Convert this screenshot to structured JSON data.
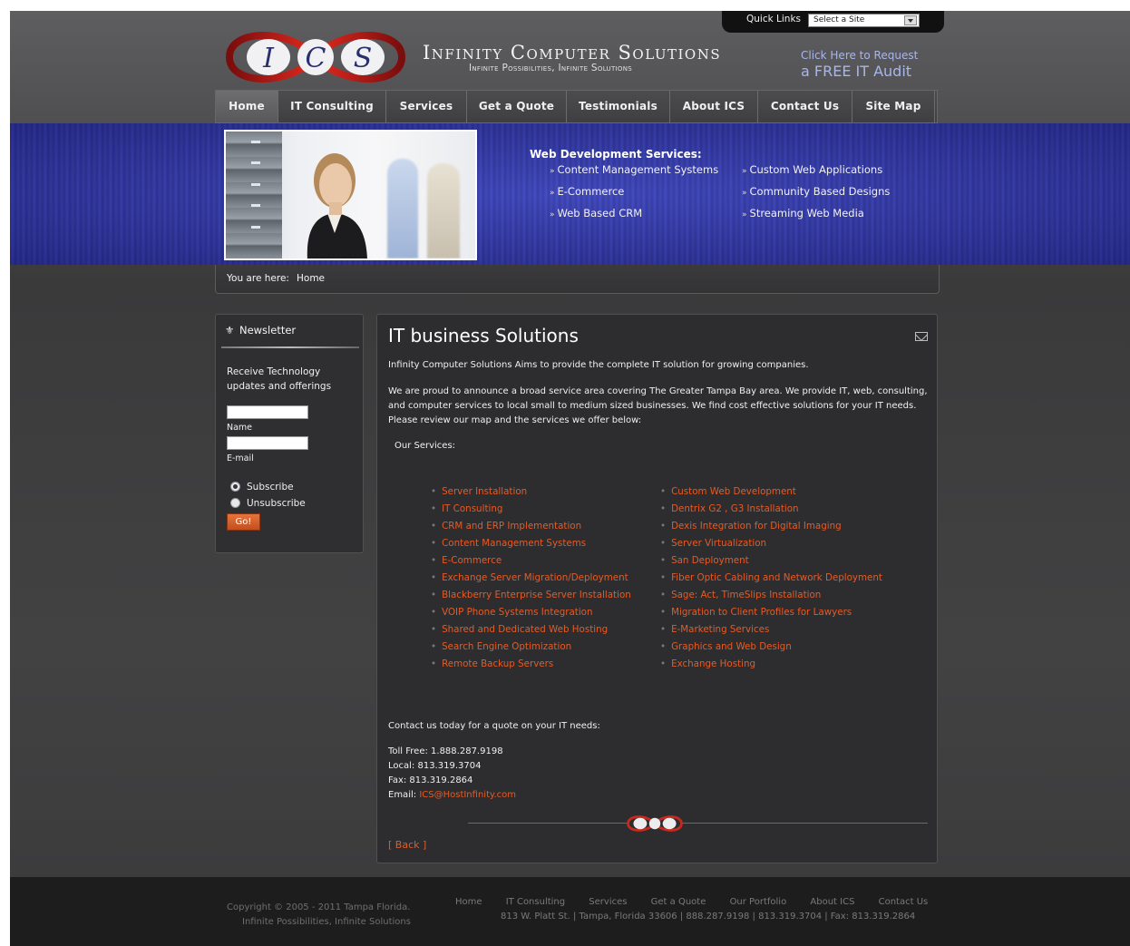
{
  "quick_links": {
    "label": "Quick Links",
    "select_value": "Select a Site"
  },
  "header": {
    "logo_text": "I C S",
    "brand_title": "Infinity Computer Solutions",
    "brand_subtitle": "Infinite Possibilities, Infinite Solutions",
    "audit_line1": "Click Here to Request",
    "audit_line2": "a FREE IT Audit"
  },
  "nav": {
    "items": [
      {
        "label": "Home",
        "active": true
      },
      {
        "label": "IT Consulting"
      },
      {
        "label": "Services"
      },
      {
        "label": "Get a Quote"
      },
      {
        "label": "Testimonials"
      },
      {
        "label": "About ICS"
      },
      {
        "label": "Contact Us"
      },
      {
        "label": "Site Map"
      }
    ]
  },
  "banner": {
    "title": "Web Development Services:",
    "col1": [
      "Content Management Systems",
      "E-Commerce",
      "Web Based CRM"
    ],
    "col2": [
      "Custom Web Applications",
      "Community Based Designs",
      "Streaming Web Media"
    ]
  },
  "breadcrumb": {
    "label": "You are here:",
    "current": "Home"
  },
  "newsletter": {
    "title": "Newsletter",
    "text": "Receive Technology updates and offerings",
    "name_label": "Name",
    "email_label": "E-mail",
    "subscribe_label": "Subscribe",
    "unsubscribe_label": "Unsubscribe",
    "go_label": "Go!"
  },
  "main": {
    "title": "IT business Solutions",
    "intro": "Infinity Computer Solutions Aims to provide the complete IT solution for growing companies.",
    "para": "We are proud to announce a broad service area covering The Greater Tampa Bay area. We provide IT, web, consulting, and computer services to local small to medium sized businesses. We find cost effective solutions for your IT needs. Please review our map and the services we offer below:",
    "services_heading": "Our Services:",
    "services_left": [
      "Server Installation",
      "IT Consulting",
      "CRM and ERP Implementation",
      "Content Management Systems",
      "E-Commerce",
      "Exchange Server Migration/Deployment",
      "Blackberry Enterprise Server Installation",
      "VOIP Phone Systems Integration",
      "Shared and Dedicated Web Hosting",
      "Search Engine Optimization",
      "Remote Backup Servers"
    ],
    "services_right": [
      "Custom Web Development",
      "Dentrix G2 , G3 Installation",
      "Dexis Integration for Digital Imaging",
      "Server Virtualization",
      "San Deployment",
      "Fiber Optic Cabling and Network Deployment",
      "Sage: Act, TimeSlips Installation",
      "Migration to Client Profiles for Lawyers",
      "E-Marketing Services",
      "Graphics and Web Design",
      "Exchange Hosting"
    ],
    "contact_intro": "Contact us today for a quote on your IT needs:",
    "toll_free": "Toll Free: 1.888.287.9198",
    "local": "Local: 813.319.3704",
    "fax": "Fax: 813.319.2864",
    "email_label": "Email:",
    "email": "ICS@HostInfinity.com",
    "back_label": "[ Back ]"
  },
  "footer": {
    "copyright": "Copyright © 2005 - 2011 Tampa Florida.",
    "tagline": "Infinite Possibilities, Infinite Solutions",
    "links": [
      "Home",
      "IT Consulting",
      "Services",
      "Get a Quote",
      "Our Portfolio",
      "About ICS",
      "Contact Us"
    ],
    "address": "813 W. Platt St.  | Tampa, Florida 33606 | 888.287.9198 | 813.319.3704 | Fax: 813.319.2864"
  },
  "colors": {
    "accent": "#e45b27",
    "banner_blue": "#2e34a6",
    "link_blue": "#a9b6e8"
  }
}
